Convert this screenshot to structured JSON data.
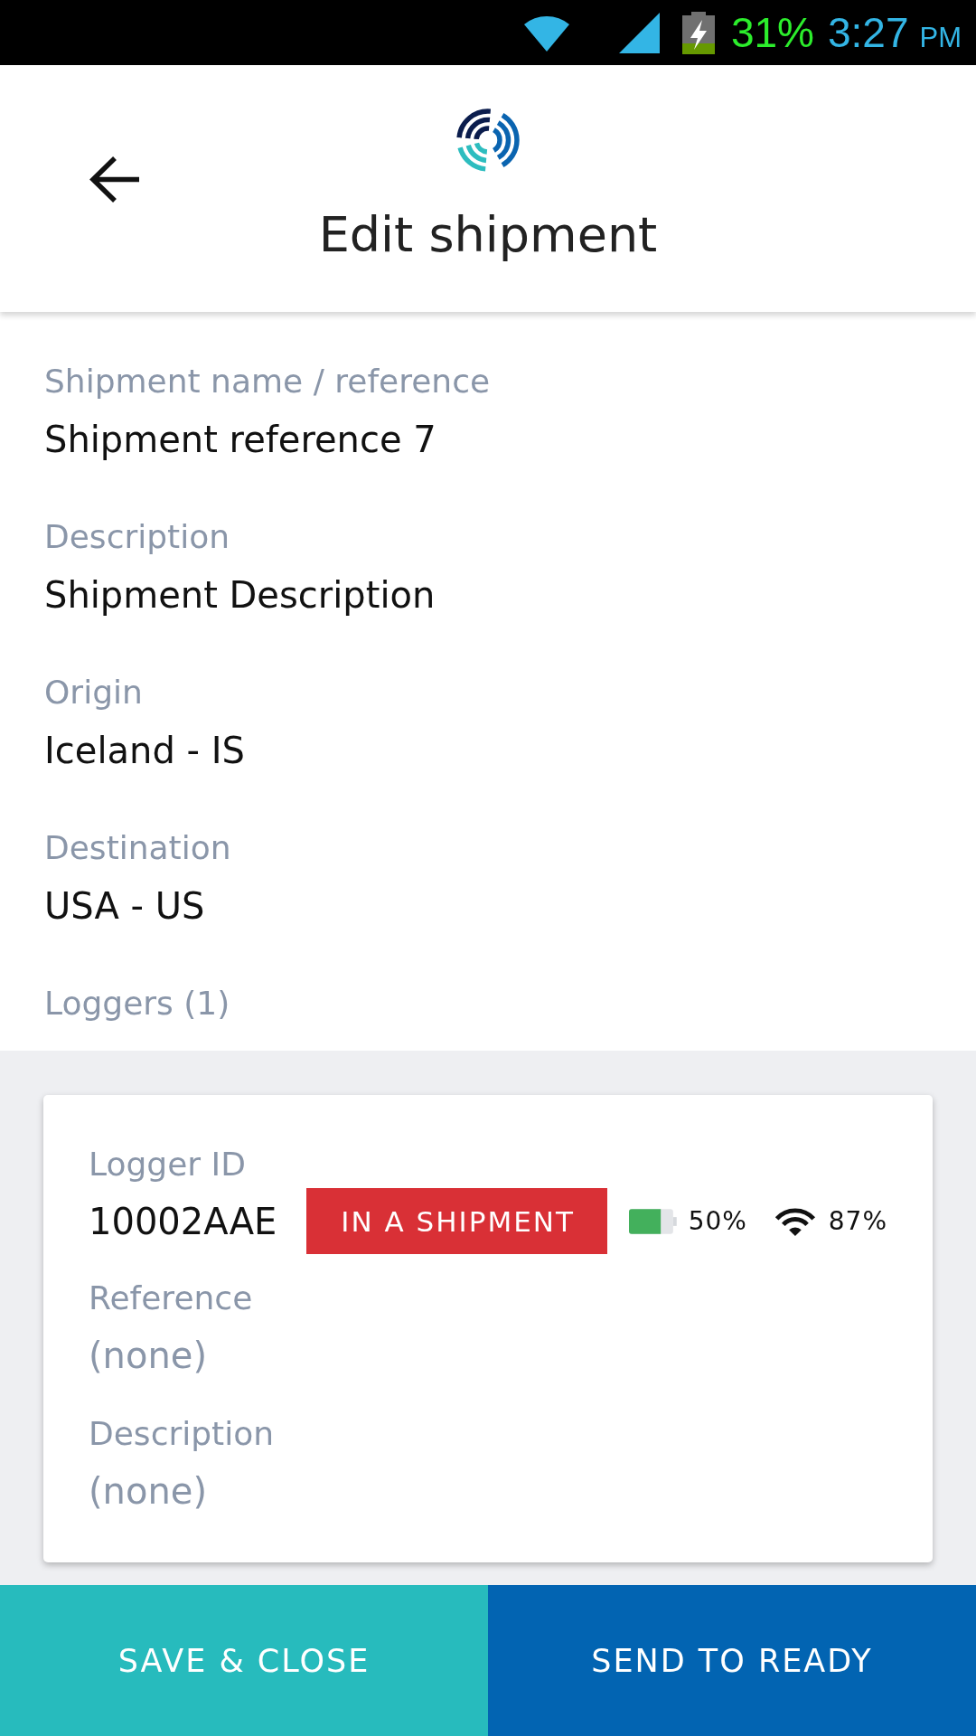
{
  "status_bar": {
    "battery": "31%",
    "time": "3:27",
    "meridiem": "PM"
  },
  "header": {
    "title": "Edit shipment"
  },
  "fields": [
    {
      "label": "Shipment name / reference",
      "value": "Shipment reference 7",
      "empty": false
    },
    {
      "label": "Description",
      "value": "Shipment Description",
      "empty": false
    },
    {
      "label": "Origin",
      "value": "Iceland - IS",
      "empty": false
    },
    {
      "label": "Destination",
      "value": "USA - US",
      "empty": false
    }
  ],
  "loggers": {
    "label": "Loggers (1)",
    "items": [
      {
        "id_label": "Logger ID",
        "id": "10002AAE",
        "status": "IN A SHIPMENT",
        "battery": "50%",
        "signal": "87%",
        "details": [
          {
            "label": "Reference",
            "value": "(none)",
            "empty": true
          },
          {
            "label": "Description",
            "value": "(none)",
            "empty": true
          }
        ]
      }
    ]
  },
  "actions": [
    {
      "label": "SAVE & CLOSE",
      "kind": "secondary"
    },
    {
      "label": "SEND TO READY",
      "kind": "primary"
    }
  ]
}
